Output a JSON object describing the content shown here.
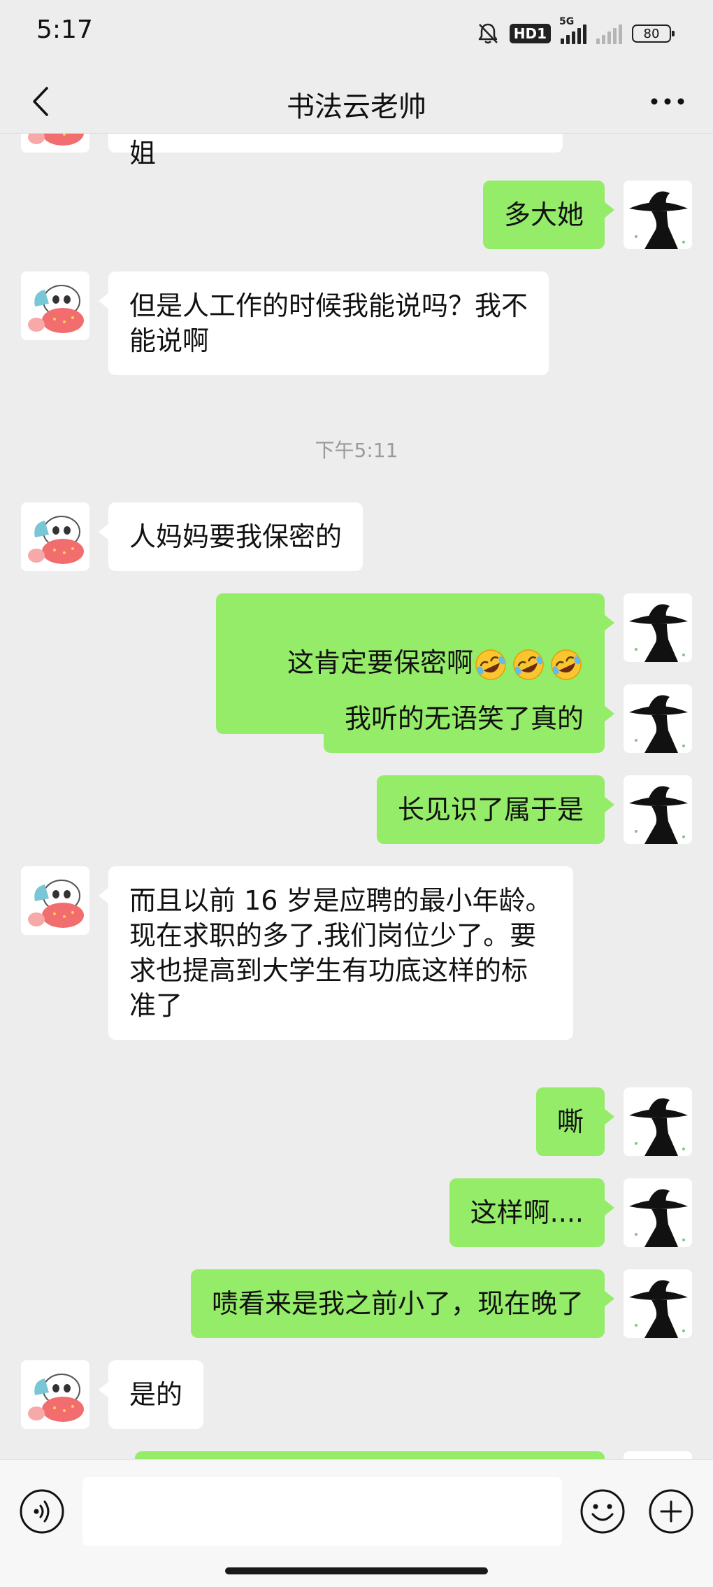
{
  "status_bar": {
    "time": "5:17",
    "hd_label": "HD1",
    "network_label": "5G",
    "battery": "80"
  },
  "nav": {
    "title": "书法云老帅"
  },
  "messages": [
    {
      "side": "left",
      "text": "就是她姐姐也在当文员，一个。姐姐",
      "partial": true
    },
    {
      "side": "right",
      "text": "多大她"
    },
    {
      "side": "left",
      "text": "但是人工作的时候我能说吗？我不\n能说啊"
    },
    {
      "side": "left",
      "text": "人妈妈要我保密的"
    },
    {
      "side": "right",
      "text": "这肯定要保密啊",
      "emoji_count": 3
    },
    {
      "side": "right",
      "text": "我听的无语笑了真的"
    },
    {
      "side": "right",
      "text": "长见识了属于是"
    },
    {
      "side": "left",
      "text": "而且以前 16 岁是应聘的最小年龄。\n现在求职的多了.我们岗位少了。要\n求也提高到大学生有功底这样的标\n准了"
    },
    {
      "side": "right",
      "text": "嘶"
    },
    {
      "side": "right",
      "text": "这样啊...."
    },
    {
      "side": "right",
      "text": "啧看来是我之前小了，现在晚了"
    },
    {
      "side": "left",
      "text": "是的"
    },
    {
      "side": "right",
      "text": "",
      "partial": true
    }
  ],
  "timestamp": "下午5:11",
  "input": {
    "value": ""
  },
  "colors": {
    "background": "#ededed",
    "bubble_self": "#95ec69",
    "bubble_other": "#ffffff",
    "timestamp": "#9a9a9a"
  },
  "icons": {
    "back": "chevron-left-icon",
    "more": "more-dots-icon",
    "voice": "voice-icon",
    "emoji": "smiley-icon",
    "plus": "plus-icon",
    "mute": "bell-off-icon",
    "emoji_in_message": "rolling-on-floor-laughing-emoji"
  }
}
